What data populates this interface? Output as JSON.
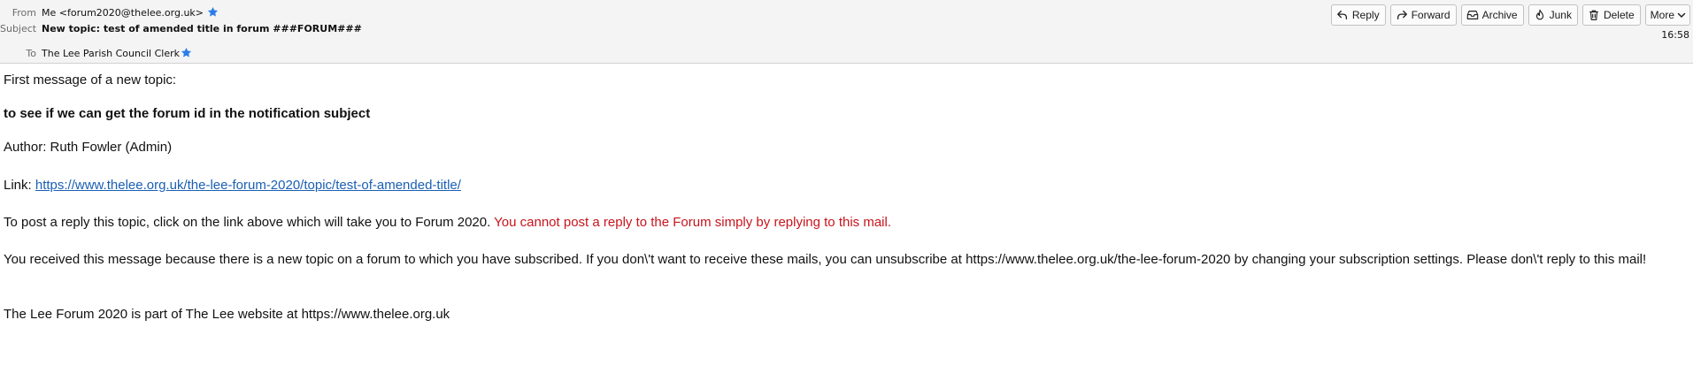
{
  "header": {
    "from_label": "From",
    "from_value": "Me <forum2020@thelee.org.uk>",
    "subject_label": "Subject",
    "subject_value": "New topic: test of amended title in forum ###FORUM###",
    "to_label": "To",
    "to_value": "The Lee Parish Council Clerk",
    "time": "16:58",
    "star_color": "#2b7de9"
  },
  "toolbar": {
    "reply": "Reply",
    "forward": "Forward",
    "archive": "Archive",
    "junk": "Junk",
    "delete": "Delete",
    "more": "More"
  },
  "message": {
    "intro": "First message of a new topic:",
    "topic_title": "to see if we can get the forum id in the notification subject",
    "author": "Author: Ruth Fowler (Admin)",
    "link_label": "Link: ",
    "link_url": "https://www.thelee.org.uk/the-lee-forum-2020/topic/test-of-amended-title/",
    "reply_info": "To post a reply this topic, click on the link above which will take you to Forum 2020. ",
    "reply_warning": "You cannot post a reply to the Forum simply by replying to this mail.",
    "subscription_note": "You received this message because there is a new topic on a forum to which you have subscribed. If you don\\'t want to receive these mails, you can unsubscribe at https://www.thelee.org.uk/the-lee-forum-2020 by changing your subscription settings. Please don\\'t reply to this mail!",
    "footer": "The Lee Forum 2020 is part of The Lee website at https://www.thelee.org.uk"
  }
}
